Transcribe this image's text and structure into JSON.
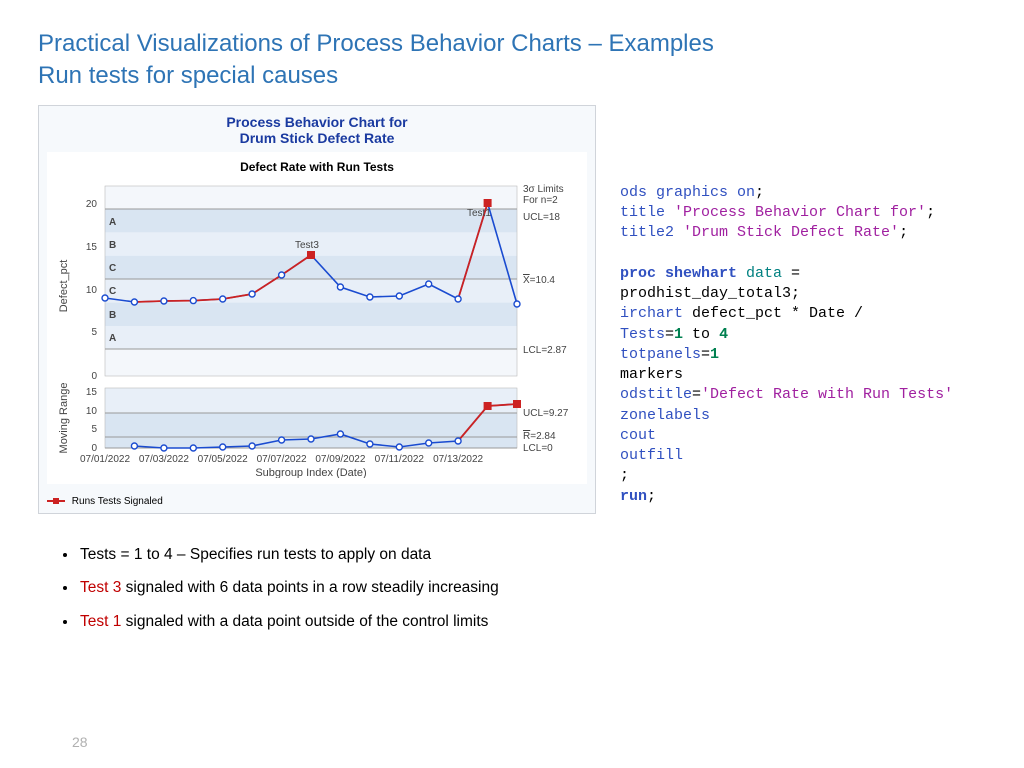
{
  "title_line1": "Practical Visualizations of Process Behavior Charts – Examples",
  "title_line2": "Run tests for special causes",
  "page_number": "28",
  "chart": {
    "main_title": "Process Behavior Chart for",
    "sub_title": "Drum Stick Defect Rate",
    "panel_title": "Defect Rate with Run Tests",
    "ylabel_top": "Defect_pct",
    "ylabel_bot": "Moving Range",
    "xlabel": "Subgroup Index (Date)",
    "sigma_note1": "3σ Limits",
    "sigma_note2": "For n=2",
    "ucl_top": "UCL=18",
    "mean_top_sym": "X",
    "mean_top_val": "=10.4",
    "lcl_top": "LCL=2.87",
    "ucl_bot": "UCL=9.27",
    "mean_bot_sym": "R",
    "mean_bot_val": "=2.84",
    "lcl_bot": "LCL=0",
    "zone_A": "A",
    "zone_B": "B",
    "zone_C": "C",
    "testlabel1": "Test1",
    "testlabel3": "Test3",
    "legend_label": "Runs Tests Signaled",
    "xticks": [
      "07/01/2022",
      "07/03/2022",
      "07/05/2022",
      "07/07/2022",
      "07/09/2022",
      "07/11/2022",
      "07/13/2022"
    ],
    "yticks_top": [
      "0",
      "5",
      "10",
      "15",
      "20"
    ],
    "yticks_bot": [
      "0",
      "5",
      "10",
      "15"
    ]
  },
  "chart_data": {
    "type": "line",
    "title": "Defect Rate with Run Tests",
    "xlabel": "Subgroup Index (Date)",
    "panels": [
      {
        "name": "Defect_pct",
        "ylabel": "Defect_pct",
        "ylim": [
          0,
          22
        ],
        "ref_lines": {
          "UCL": 18,
          "Mean": 10.4,
          "LCL": 2.87
        },
        "zone_bounds": {
          "A_upper": 18,
          "B_upper": 15.47,
          "C_upper": 12.93,
          "center": 10.4,
          "C_lower": 7.87,
          "B_lower": 5.33,
          "A_lower": 2.87
        },
        "x": [
          "07/01/2022",
          "07/02/2022",
          "07/03/2022",
          "07/04/2022",
          "07/05/2022",
          "07/06/2022",
          "07/07/2022",
          "07/08/2022",
          "07/09/2022",
          "07/10/2022",
          "07/11/2022",
          "07/12/2022",
          "07/13/2022",
          "07/14/2022"
        ],
        "y": [
          9.0,
          8.5,
          8.6,
          8.7,
          8.9,
          9.5,
          11.7,
          14.0,
          10.3,
          9.1,
          9.3,
          10.7,
          8.9,
          20.0,
          8.3
        ],
        "signaled_tests": [
          {
            "test": 3,
            "x_index": 7,
            "note": "6 points steadily increasing"
          },
          {
            "test": 1,
            "x_index": 13,
            "note": "point outside control limits"
          }
        ]
      },
      {
        "name": "Moving Range",
        "ylabel": "Moving Range",
        "ylim": [
          0,
          16
        ],
        "ref_lines": {
          "UCL": 9.27,
          "Mean": 2.84,
          "LCL": 0
        },
        "x": [
          "07/02/2022",
          "07/03/2022",
          "07/04/2022",
          "07/05/2022",
          "07/06/2022",
          "07/07/2022",
          "07/08/2022",
          "07/09/2022",
          "07/10/2022",
          "07/11/2022",
          "07/12/2022",
          "07/13/2022",
          "07/14/2022"
        ],
        "y": [
          0.5,
          0.1,
          0.1,
          0.2,
          0.6,
          2.2,
          2.3,
          3.7,
          1.2,
          0.2,
          1.4,
          1.8,
          11.1,
          11.7
        ],
        "signaled_indices": [
          12,
          13
        ]
      }
    ],
    "legend": [
      "Runs Tests Signaled"
    ]
  },
  "code": {
    "l1a": "ods graphics on",
    "l1b": ";",
    "l2a": "title",
    "l2b": " 'Process Behavior Chart for'",
    "l2c": ";",
    "l3a": "title2",
    "l3b": " 'Drum Stick Defect Rate'",
    "l3c": ";",
    "l5a": "proc shewhart ",
    "l5b": "data",
    "l5c": " =",
    "l6": "prodhist_day_total3;",
    "l7a": "irchart ",
    "l7b": "defect_pct * Date /",
    "l8a": "Tests",
    "l8b": "=",
    "l8c": "1",
    "l8d": " to ",
    "l8e": "4",
    "l9a": "totpanels",
    "l9b": "=",
    "l9c": "1",
    "l10": "markers",
    "l11a": "odstitle",
    "l11b": "=",
    "l11c": "'Defect Rate with Run Tests'",
    "l13": "zonelabels",
    "l14": "cout",
    "l15": "outfill",
    "l16": ";",
    "l17a": "run",
    "l17b": ";"
  },
  "bullets": {
    "b1": "Tests = 1 to 4 – Specifies run tests to apply on data",
    "b2_lead": "Test 3",
    "b2_rest": " signaled with 6 data points in a row steadily increasing",
    "b3_lead": "Test 1",
    "b3_rest": " signaled with a data point outside of the control limits"
  }
}
